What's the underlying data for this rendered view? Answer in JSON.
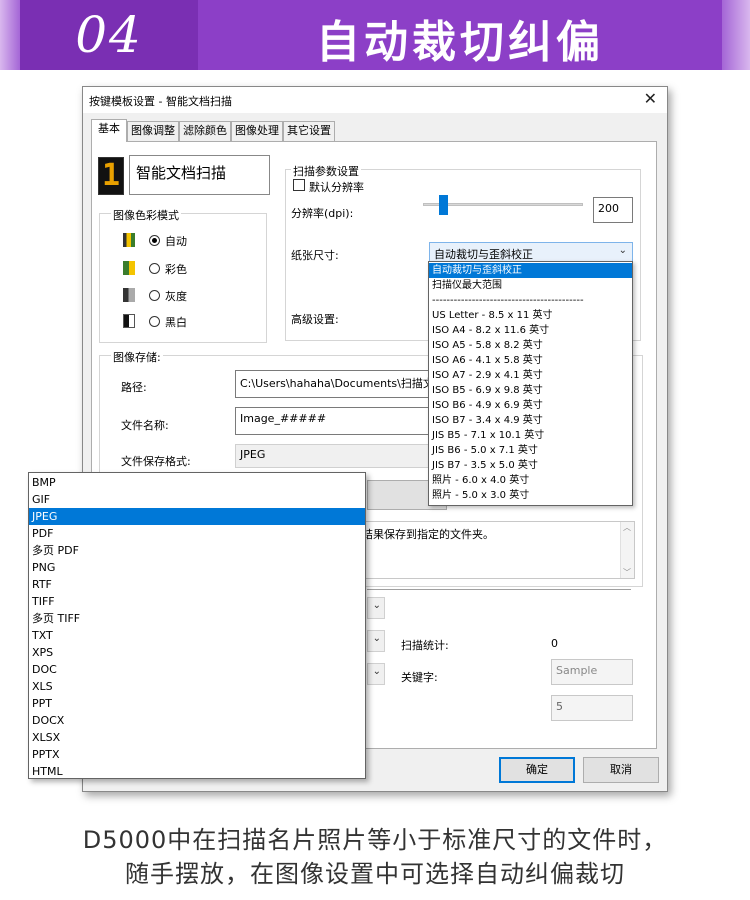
{
  "banner": {
    "number": "04",
    "title": "自动裁切纠偏"
  },
  "dialog": {
    "title": "按键模板设置 - 智能文档扫描",
    "close_label": "✕",
    "tabs": [
      {
        "label": "基本"
      },
      {
        "label": "图像调整"
      },
      {
        "label": "滤除颜色"
      },
      {
        "label": "图像处理"
      },
      {
        "label": "其它设置"
      }
    ],
    "lcd_digit": "1",
    "brand_text": "智能文档扫描",
    "color_mode": {
      "title": "图像色彩模式",
      "options": [
        {
          "label": "自动",
          "selected": true
        },
        {
          "label": "彩色",
          "selected": false
        },
        {
          "label": "灰度",
          "selected": false
        },
        {
          "label": "黑白",
          "selected": false
        }
      ]
    },
    "scan_params": {
      "title": "扫描参数设置",
      "default_resolution_label": "默认分辨率",
      "default_resolution_checked": false,
      "dpi_label": "分辨率(dpi):",
      "dpi_value": "200",
      "paper_size_label": "纸张尺寸:",
      "paper_size_value": "自动裁切与歪斜校正",
      "advanced_label": "高级设置:"
    },
    "paper_size_options": [
      {
        "label": "自动裁切与歪斜校正",
        "selected": true
      },
      {
        "label": "扫描仪最大范围"
      },
      {
        "label": "------------------------------------------"
      },
      {
        "label": "US Letter - 8.5 x 11 英寸"
      },
      {
        "label": "ISO A4 - 8.2 x 11.6 英寸"
      },
      {
        "label": "ISO A5 - 5.8 x 8.2 英寸"
      },
      {
        "label": "ISO A6 - 4.1 x 5.8 英寸"
      },
      {
        "label": "ISO A7 -  2.9 x 4.1 英寸"
      },
      {
        "label": "ISO B5 - 6.9 x 9.8 英寸"
      },
      {
        "label": "ISO B6 - 4.9 x 6.9 英寸"
      },
      {
        "label": "ISO B7 -  3.4 x 4.9 英寸"
      },
      {
        "label": "JIS B5 - 7.1 x 10.1 英寸"
      },
      {
        "label": "JIS B6 - 5.0 x 7.1 英寸"
      },
      {
        "label": "JIS B7 - 3.5 x 5.0 英寸"
      },
      {
        "label": "照片 - 6.0 x 4.0 英寸"
      },
      {
        "label": "照片 - 5.0 x 3.0 英寸"
      }
    ],
    "storage": {
      "title": "图像存储:",
      "path_label": "路径:",
      "path_value": "C:\\Users\\hahaha\\Documents\\扫描文档",
      "filename_label": "文件名称:",
      "filename_value": "Image_#####",
      "format_label": "文件保存格式:",
      "format_value": "JPEG"
    },
    "description_text": "结果保存到指定的文件夹。",
    "scan_count_label": "扫描统计:",
    "scan_count_value": "0",
    "keyword_label": "关键字:",
    "keyword_placeholder": "Sample",
    "number_value": "5",
    "ok_label": "确定",
    "cancel_label": "取消"
  },
  "format_options": [
    {
      "label": "BMP"
    },
    {
      "label": "GIF"
    },
    {
      "label": "JPEG",
      "selected": true
    },
    {
      "label": "PDF"
    },
    {
      "label": "多页 PDF"
    },
    {
      "label": "PNG"
    },
    {
      "label": "RTF"
    },
    {
      "label": "TIFF"
    },
    {
      "label": "多页 TIFF"
    },
    {
      "label": "TXT"
    },
    {
      "label": "XPS"
    },
    {
      "label": "DOC"
    },
    {
      "label": "XLS"
    },
    {
      "label": "PPT"
    },
    {
      "label": "DOCX"
    },
    {
      "label": "XLSX"
    },
    {
      "label": "PPTX"
    },
    {
      "label": "HTML"
    }
  ],
  "caption": {
    "line1": "D5000中在扫描名片照片等小于标准尺寸的文件时，",
    "line2": "随手摆放，在图像设置中可选择自动纠偏裁切"
  },
  "colors": {
    "banner": "#8c3fc7",
    "selection": "#0078d7"
  }
}
